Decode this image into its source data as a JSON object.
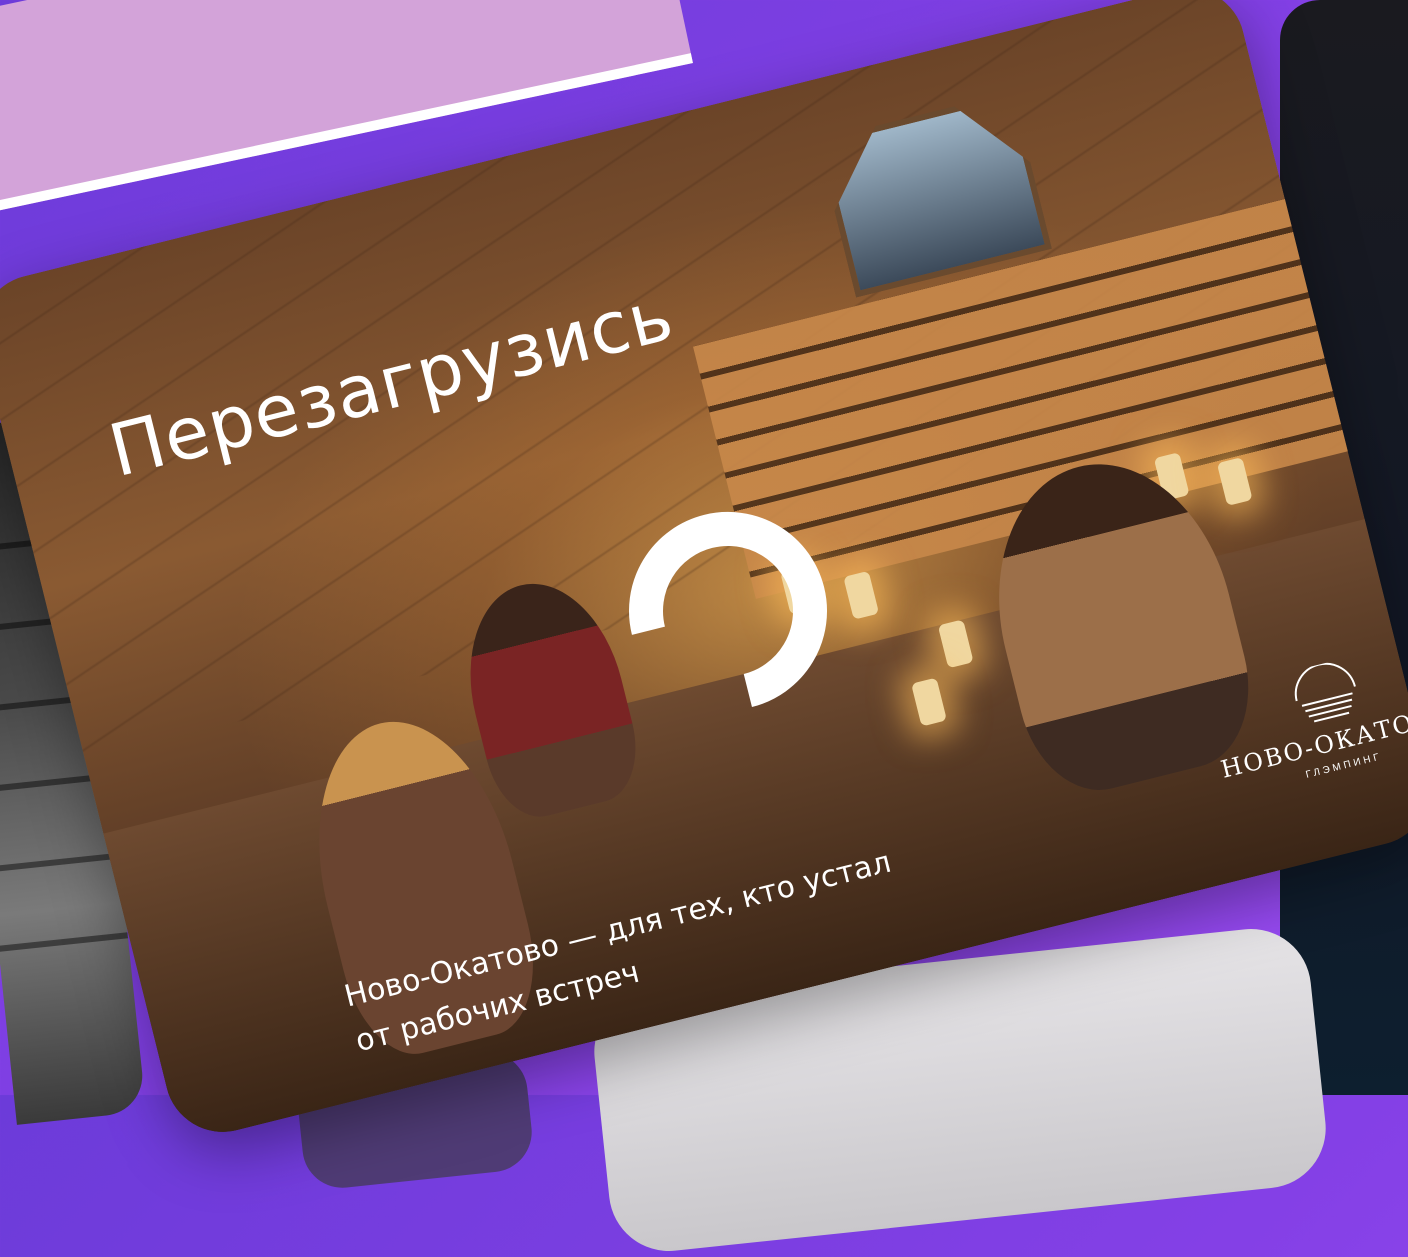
{
  "headline": "Перезагрузись",
  "tagline_line1": "Ново-Окатово — для тех, кто устал",
  "tagline_line2": "от рабочих встреч",
  "brand": {
    "name": "НОВО-ОКАТОВО",
    "subtitle": "ГЛЭМПИНГ",
    "logo_icon": "sunrise-waves-logo"
  },
  "loader_icon": "loading-spinner-icon",
  "colors": {
    "background": "#8440e6",
    "text": "#ffffff"
  }
}
